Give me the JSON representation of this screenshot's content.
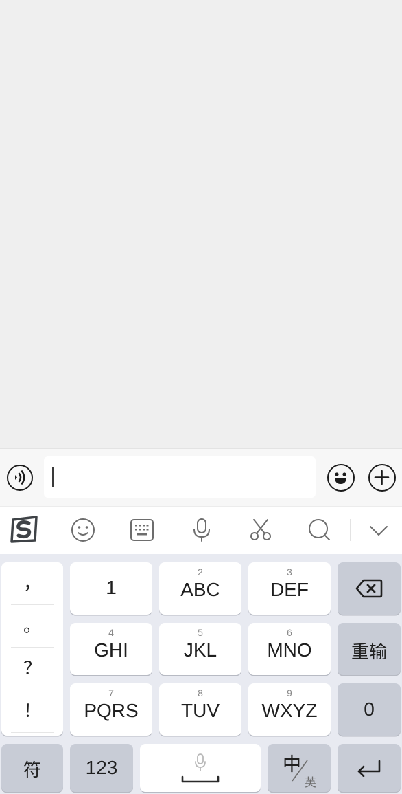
{
  "input_bar": {
    "text_value": "",
    "voice_icon": "voice-toggle-icon",
    "emoji_icon": "emoji-icon",
    "plus_icon": "add-icon"
  },
  "toolbar": {
    "icons": [
      "sogou-logo-icon",
      "emoji-face-icon",
      "keyboard-icon",
      "microphone-icon",
      "scissors-icon",
      "search-icon",
      "chevron-down-icon"
    ]
  },
  "keyboard": {
    "punctuation": [
      "，",
      "。",
      "？",
      "！"
    ],
    "keys": {
      "k1": {
        "main": "1",
        "sub": ""
      },
      "k2": {
        "main": "ABC",
        "sub": "2"
      },
      "k3": {
        "main": "DEF",
        "sub": "3"
      },
      "k4": {
        "main": "GHI",
        "sub": "4"
      },
      "k5": {
        "main": "JKL",
        "sub": "5"
      },
      "k6": {
        "main": "MNO",
        "sub": "6"
      },
      "k7": {
        "main": "PQRS",
        "sub": "7"
      },
      "k8": {
        "main": "TUV",
        "sub": "8"
      },
      "k9": {
        "main": "WXYZ",
        "sub": "9"
      },
      "k0": {
        "main": "0"
      }
    },
    "reinput": "重输",
    "symbols": "符",
    "numbers": "123",
    "lang_main": "中",
    "lang_sub": "英"
  },
  "colors": {
    "keyboard_bg": "#e8eaf1",
    "func_key": "#c8ccd6",
    "key": "#ffffff"
  }
}
